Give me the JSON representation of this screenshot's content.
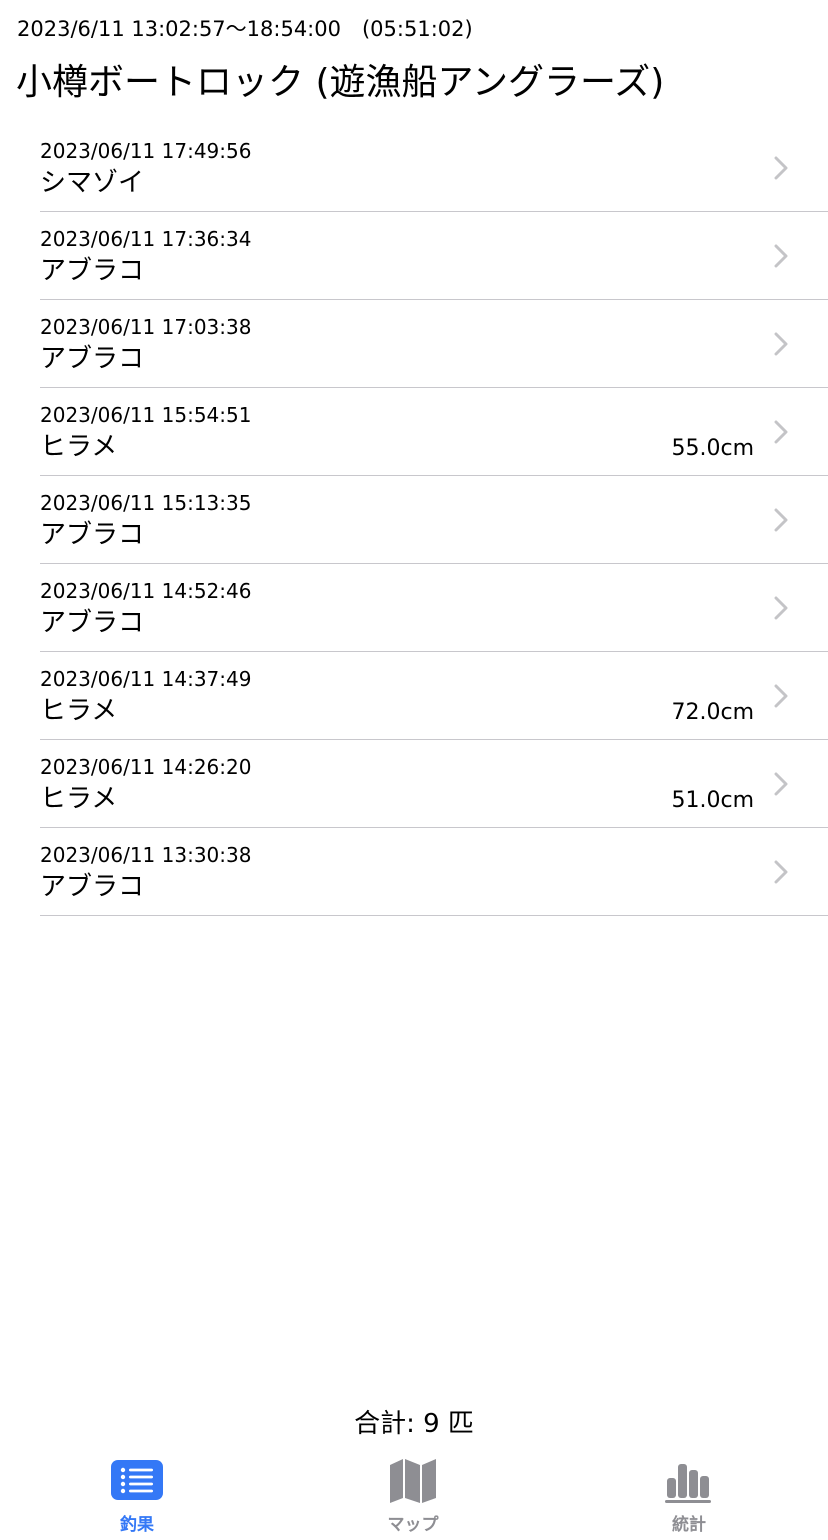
{
  "header": {
    "session_time": "2023/6/11 13:02:57〜18:54:00　(05:51:02)",
    "title": "小樽ボートロック (遊漁船アングラーズ)"
  },
  "catches": [
    {
      "datetime": "2023/06/11 17:49:56",
      "species": "シマゾイ",
      "size": ""
    },
    {
      "datetime": "2023/06/11 17:36:34",
      "species": "アブラコ",
      "size": ""
    },
    {
      "datetime": "2023/06/11 17:03:38",
      "species": "アブラコ",
      "size": ""
    },
    {
      "datetime": "2023/06/11 15:54:51",
      "species": "ヒラメ",
      "size": "55.0cm"
    },
    {
      "datetime": "2023/06/11 15:13:35",
      "species": "アブラコ",
      "size": ""
    },
    {
      "datetime": "2023/06/11 14:52:46",
      "species": "アブラコ",
      "size": ""
    },
    {
      "datetime": "2023/06/11 14:37:49",
      "species": "ヒラメ",
      "size": "72.0cm"
    },
    {
      "datetime": "2023/06/11 14:26:20",
      "species": "ヒラメ",
      "size": "51.0cm"
    },
    {
      "datetime": "2023/06/11 13:30:38",
      "species": "アブラコ",
      "size": ""
    }
  ],
  "footer": {
    "total": "合計: 9 匹"
  },
  "tabs": [
    {
      "label": "釣果",
      "icon": "list-icon",
      "active": true
    },
    {
      "label": "マップ",
      "icon": "map-icon",
      "active": false
    },
    {
      "label": "統計",
      "icon": "bar-chart-icon",
      "active": false
    }
  ],
  "colors": {
    "accent": "#3478f6",
    "inactive": "#8e8e93",
    "separator": "#c8c7cc",
    "chevron": "#c4c4c7"
  }
}
